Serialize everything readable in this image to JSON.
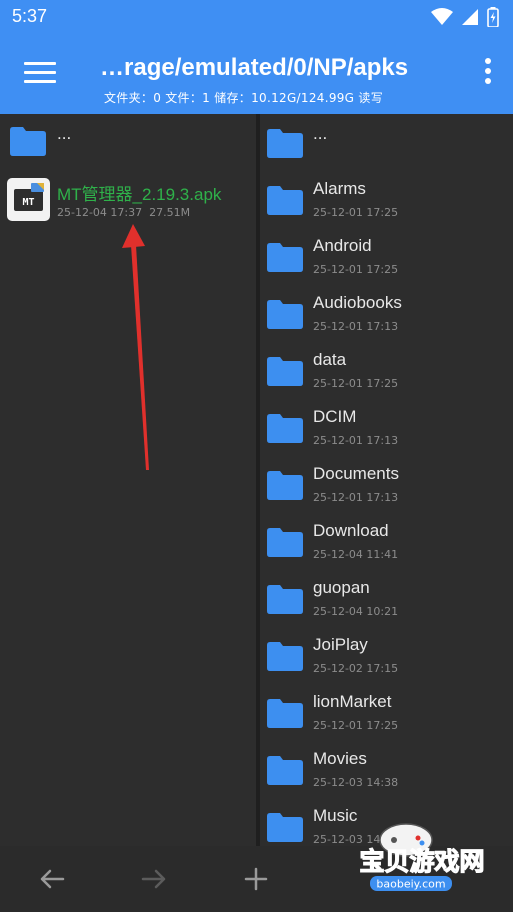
{
  "status_bar": {
    "time": "5:37",
    "icons": [
      "wifi-icon",
      "signal-icon",
      "battery-charging-icon"
    ]
  },
  "app_bar": {
    "menu_icon": "hamburger-menu-icon",
    "path_title": "…rage/emulated/0/NP/apks",
    "subtitle": "文件夹：0 文件：1  储存：10.12G/124.99G   读写",
    "more_icon": "more-vert-icon",
    "accent_color": "#3f8ff3"
  },
  "left_pane": {
    "parent_label": "...",
    "files": [
      {
        "name": "MT管理器_2.19.3.apk",
        "date": "25-12-04 17:37",
        "size": "27.51M",
        "icon": "mt-app-icon",
        "name_color": "#2fb14a"
      }
    ]
  },
  "right_pane": {
    "parent_label": "...",
    "folders": [
      {
        "name": "Alarms",
        "date": "25-12-01 17:25"
      },
      {
        "name": "Android",
        "date": "25-12-01 17:25"
      },
      {
        "name": "Audiobooks",
        "date": "25-12-01 17:13"
      },
      {
        "name": "data",
        "date": "25-12-01 17:25"
      },
      {
        "name": "DCIM",
        "date": "25-12-01 17:13"
      },
      {
        "name": "Documents",
        "date": "25-12-01 17:13"
      },
      {
        "name": "Download",
        "date": "25-12-04 11:41"
      },
      {
        "name": "guopan",
        "date": "25-12-04 10:21"
      },
      {
        "name": "JoiPlay",
        "date": "25-12-02 17:15"
      },
      {
        "name": "lionMarket",
        "date": "25-12-01 17:25"
      },
      {
        "name": "Movies",
        "date": "25-12-03 14:38"
      },
      {
        "name": "Music",
        "date": "25-12-03 14:38"
      }
    ],
    "folder_color": "#3d8ff0"
  },
  "bottom_bar": {
    "buttons": [
      "back-arrow-icon",
      "forward-arrow-icon",
      "add-icon"
    ]
  },
  "watermark": {
    "title": "宝贝游戏网",
    "url": "baobeiy.com"
  }
}
